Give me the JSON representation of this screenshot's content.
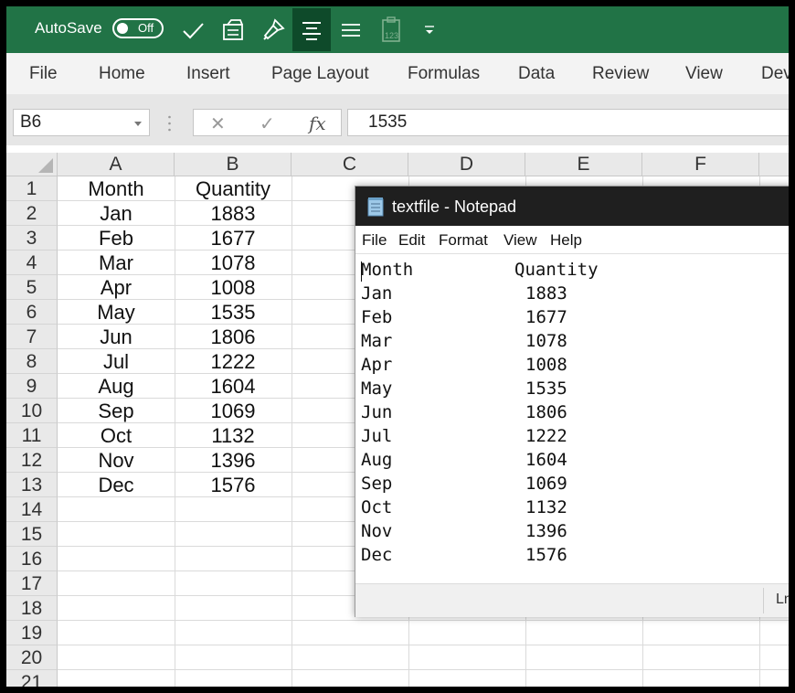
{
  "qat": {
    "autosave_label": "AutoSave",
    "toggle_state": "Off",
    "accent": "#217346"
  },
  "ribbon_tabs": [
    "File",
    "Home",
    "Insert",
    "Page Layout",
    "Formulas",
    "Data",
    "Review",
    "View",
    "Dev"
  ],
  "formula_bar": {
    "name_box": "B6",
    "cancel_icon": "✕",
    "enter_icon": "✓",
    "function_icon": "fx",
    "content": "1535"
  },
  "columns": [
    "A",
    "B",
    "C",
    "D",
    "E",
    "F"
  ],
  "rows": [
    "1",
    "2",
    "3",
    "4",
    "5",
    "6",
    "7",
    "8",
    "9",
    "10",
    "11",
    "12",
    "13",
    "14",
    "15",
    "16",
    "17",
    "18",
    "19",
    "20",
    "21"
  ],
  "sheet": {
    "header": [
      "Month",
      "Quantity"
    ],
    "data": [
      [
        "Jan",
        "1883"
      ],
      [
        "Feb",
        "1677"
      ],
      [
        "Mar",
        "1078"
      ],
      [
        "Apr",
        "1008"
      ],
      [
        "May",
        "1535"
      ],
      [
        "Jun",
        "1806"
      ],
      [
        "Jul",
        "1222"
      ],
      [
        "Aug",
        "1604"
      ],
      [
        "Sep",
        "1069"
      ],
      [
        "Oct",
        "1132"
      ],
      [
        "Nov",
        "1396"
      ],
      [
        "Dec",
        "1576"
      ]
    ]
  },
  "notepad": {
    "title": "textfile - Notepad",
    "menu": [
      "File",
      "Edit",
      "Format",
      "View",
      "Help"
    ],
    "lines": [
      [
        "Month",
        "Quantity"
      ],
      [
        "Jan",
        "1883"
      ],
      [
        "Feb",
        "1677"
      ],
      [
        "Mar",
        "1078"
      ],
      [
        "Apr",
        "1008"
      ],
      [
        "May",
        "1535"
      ],
      [
        "Jun",
        "1806"
      ],
      [
        "Jul",
        "1222"
      ],
      [
        "Aug",
        "1604"
      ],
      [
        "Sep",
        "1069"
      ],
      [
        "Oct",
        "1132"
      ],
      [
        "Nov",
        "1396"
      ],
      [
        "Dec",
        "1576"
      ]
    ],
    "status_text": "Ln"
  }
}
